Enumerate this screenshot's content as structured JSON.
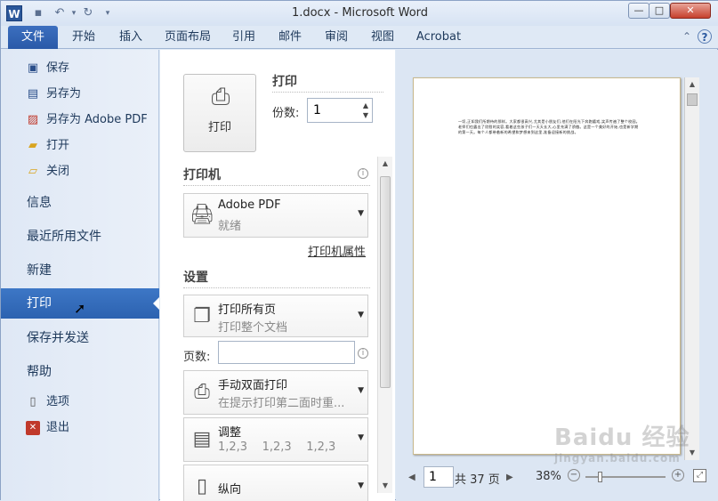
{
  "window": {
    "title": "1.docx - Microsoft Word",
    "app_icon": "W",
    "controls": {
      "minimize": "—",
      "maximize": "□",
      "close": "✕"
    }
  },
  "quick_access": {
    "save_icon": "save-icon",
    "undo_icon": "undo-icon",
    "redo_icon": "redo-icon",
    "customize_icon": "dropdown-icon"
  },
  "ribbon": {
    "tabs": [
      "文件",
      "开始",
      "插入",
      "页面布局",
      "引用",
      "邮件",
      "审阅",
      "视图",
      "Acrobat"
    ]
  },
  "left_nav": {
    "small_items": [
      {
        "label": "保存",
        "icon": "save-icon"
      },
      {
        "label": "另存为",
        "icon": "save-as-icon"
      },
      {
        "label": "另存为 Adobe PDF",
        "icon": "pdf-icon"
      },
      {
        "label": "打开",
        "icon": "open-folder-icon"
      },
      {
        "label": "关闭",
        "icon": "close-folder-icon"
      }
    ],
    "big_items": [
      "信息",
      "最近所用文件",
      "新建",
      "打印",
      "保存并发送",
      "帮助"
    ],
    "active": "打印",
    "bottom_items": [
      {
        "label": "选项",
        "icon": "options-icon"
      },
      {
        "label": "退出",
        "icon": "exit-icon"
      }
    ]
  },
  "print_panel": {
    "title": "打印",
    "print_button_label": "打印",
    "copies_label": "份数:",
    "copies_value": "1",
    "printer_section": "打印机",
    "printer_name": "Adobe PDF",
    "printer_status": "就绪",
    "printer_properties_link": "打印机属性",
    "settings_section": "设置",
    "settings": [
      {
        "title": "打印所有页",
        "subtitle": "打印整个文档",
        "icon": "pages-icon"
      },
      {
        "title": "手动双面打印",
        "subtitle": "在提示打印第二面时重...",
        "icon": "duplex-icon"
      },
      {
        "title": "调整",
        "subtitle": "1,2,3    1,2,3    1,2,3",
        "icon": "collate-icon"
      },
      {
        "title": "纵向",
        "subtitle": "",
        "icon": "portrait-icon"
      }
    ],
    "pages_label": "页数:",
    "pages_value": ""
  },
  "preview": {
    "page_text": "一切,正如我们所期待的那样。大家都很高兴,尤其是小朋友们,他们在阳光下奔跑嬉戏,笑声传遍了整个校园。老师们也露出了欣慰的笑容,看着这些孩子们一天天长大,心里充满了骄傲。这是一个美好的开始,也是新学期的第一天。每个人都带着新的希望和梦想来到这里,准备迎接新的挑战。",
    "current_page": "1",
    "total_pages": "共 37 页",
    "zoom_level": "38%"
  },
  "watermark": {
    "line1": "Baidu 经验",
    "line2": "jingyan.baidu.com"
  }
}
